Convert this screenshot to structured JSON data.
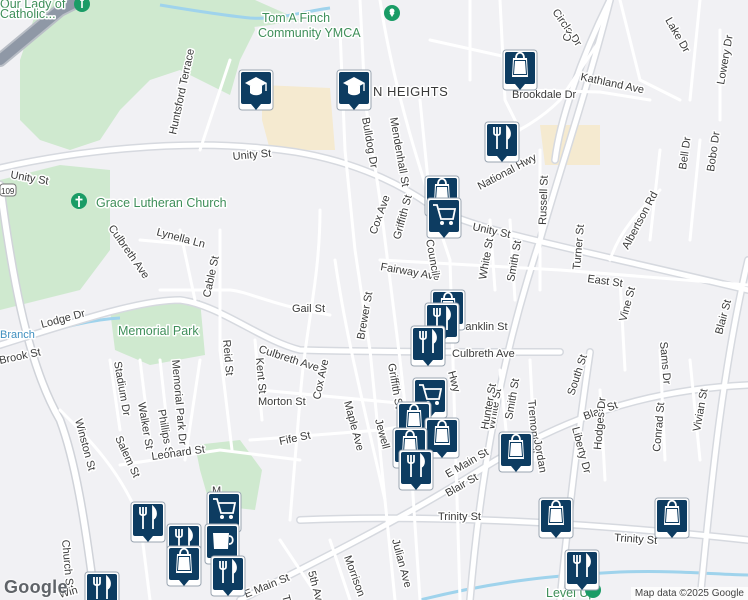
{
  "streets": {
    "unity_w": "Unity St",
    "unity_mid": "Unity St",
    "unity_e": "Unity St",
    "lodge": "Lodge Dr",
    "culbreth_w": "Culbreth Ave",
    "culbreth_e": "Culbreth Ave",
    "culbreth_ave_left": "Culbreth Ave",
    "lynella": "Lynella Ln",
    "cable": "Cable St",
    "huntsford": "Huntsford Terrace",
    "gail": "Gail St",
    "cox_n": "Cox Ave",
    "cox_s": "Cox Ave",
    "brewer": "Brewer St",
    "fairway": "Fairway Ave",
    "griffith_n": "Griffith St",
    "griffith_s": "Griffith St",
    "council": "Council",
    "mendenhall": "Mendenhall St",
    "bulldog": "Bulldog Dr",
    "national_hwy": "National Hwy",
    "white_n": "White St",
    "white_s": "White St",
    "smith_n": "Smith St",
    "smith_s": "Smith St",
    "russell": "Russell St",
    "turner": "Turner St",
    "east": "East St",
    "albertson": "Albertson Rd",
    "bell": "Bell Dr",
    "bobo": "Bobo Dr",
    "kathland": "Kathland Ave",
    "brookdale": "Brookdale Dr",
    "circle": "Circle Dr",
    "lake": "Lake Dr",
    "lowery": "Lowery Dr",
    "vine": "Vine St",
    "blair_ne": "Blair St",
    "blair_mid": "Blair St",
    "blair_s": "Blair St",
    "franklin": "Franklin St",
    "tremont": "Tremont St",
    "south": "South St",
    "sams": "Sams Dr",
    "conrad": "Conrad St",
    "vivian": "Vivian St",
    "hodges": "Hodges Dr",
    "liberty": "Liberty Dr",
    "hunter": "Hunter St",
    "jordan": "Jordan",
    "main_e": "E Main St",
    "main_w": "E Main St",
    "trinity_w": "Trinity St",
    "trinity_e": "Trinity St",
    "julian": "Julian Ave",
    "morrison": "Morrison",
    "fifth": "5th Ave",
    "maple": "Maple Ave",
    "jewell": "Jewell",
    "fife": "Fife St",
    "morton": "Morton St",
    "kent": "Kent St",
    "reid": "Reid St",
    "memorial_park_dr": "Memorial Park Dr",
    "stadium": "Stadium Dr",
    "walker": "Walker St",
    "phillips": "Phillips St",
    "leonard": "Leonard St",
    "salem": "Salem St",
    "winston": "Winston St",
    "church": "Church St",
    "brook": "Brook St",
    "win": "Win",
    "hwy": "Hwy",
    "cr": "Cr",
    "m": "M",
    "ta": "Ta",
    "sr": "109"
  },
  "places": {
    "ymca": "Tom A Finch Community YMCA",
    "ymca_line1": "Tom A Finch",
    "ymca_line2": "Community YMCA",
    "grace": "Grace Lutheran Church",
    "memorial_park": "Memorial Park",
    "catholic_line1": "Our Lady of",
    "catholic_line2": "Catholic...",
    "heights_a": "N HEIGHTS",
    "branch": "Branch",
    "level_up": "Level Up"
  },
  "colors": {
    "road": "#ffffff",
    "road_casing": "#d6d9df",
    "highway": "#c9cdd4",
    "park": "#cfe9cf",
    "campus": "#f5ead0",
    "water": "#9fd3ec",
    "poi_blue": "#0d3c61",
    "poi_green": "#1a9c66",
    "label": "#3a3a3a"
  },
  "pois": [
    {
      "type": "school",
      "icon": "school-icon"
    },
    {
      "type": "school",
      "icon": "school-icon"
    },
    {
      "type": "shopping",
      "icon": "shopping-bag-icon"
    },
    {
      "type": "restaurant",
      "icon": "fork-knife-icon"
    },
    {
      "type": "shopping",
      "icon": "shopping-bag-icon"
    },
    {
      "type": "grocery",
      "icon": "shopping-cart-icon"
    },
    {
      "type": "shopping",
      "icon": "shopping-bag-icon"
    },
    {
      "type": "restaurant",
      "icon": "fork-knife-icon"
    },
    {
      "type": "restaurant",
      "icon": "fork-knife-icon"
    },
    {
      "type": "grocery",
      "icon": "shopping-cart-icon"
    },
    {
      "type": "shopping",
      "icon": "shopping-bag-icon"
    },
    {
      "type": "shopping",
      "icon": "shopping-bag-icon"
    },
    {
      "type": "shopping",
      "icon": "shopping-bag-icon"
    },
    {
      "type": "restaurant",
      "icon": "fork-knife-icon"
    },
    {
      "type": "shopping",
      "icon": "shopping-bag-icon"
    },
    {
      "type": "shopping",
      "icon": "shopping-bag-icon"
    },
    {
      "type": "shopping",
      "icon": "shopping-bag-icon"
    },
    {
      "type": "restaurant",
      "icon": "fork-knife-icon"
    },
    {
      "type": "grocery",
      "icon": "shopping-cart-icon"
    },
    {
      "type": "restaurant",
      "icon": "fork-knife-icon"
    },
    {
      "type": "cafe",
      "icon": "coffee-cup-icon"
    },
    {
      "type": "shopping",
      "icon": "shopping-bag-icon"
    },
    {
      "type": "restaurant",
      "icon": "fork-knife-icon"
    },
    {
      "type": "restaurant",
      "icon": "fork-knife-icon"
    },
    {
      "type": "restaurant",
      "icon": "fork-knife-icon"
    }
  ],
  "attribution": "Map data ©2025 Google",
  "logo": "Google"
}
